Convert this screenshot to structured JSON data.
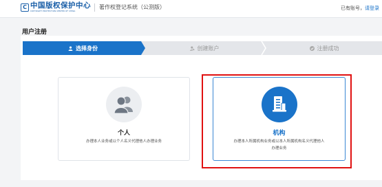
{
  "header": {
    "logo_mark": "C",
    "logo_cn": "中国版权保护中心",
    "logo_en": "COPYRIGHT PROTECTION CENTER OF CHINA",
    "app_title": "著作权登记系统（公测版）",
    "account_prefix": "已有账号，",
    "account_link": "请登录"
  },
  "page": {
    "title": "用户注册"
  },
  "steps": [
    {
      "label": "选择身份",
      "icon": "user-icon",
      "state": "active"
    },
    {
      "label": "创建账户",
      "icon": "user-edit-icon",
      "state": "inactive"
    },
    {
      "label": "注册成功",
      "icon": "check-circle-icon",
      "state": "inactive"
    }
  ],
  "options": {
    "personal": {
      "title": "个人",
      "desc": "办理本人业务或以个人名义代理他人办理业务",
      "icon": "users-icon"
    },
    "org": {
      "title": "机构",
      "desc_line1": "办理本人所属机构业务或以本人所属机构名义代理他人",
      "desc_line2": "办理业务",
      "icon": "building-doc-icon"
    }
  },
  "colors": {
    "accent": "#1a73c9",
    "step_inactive": "#e4e6ea",
    "highlight": "#e01010"
  }
}
